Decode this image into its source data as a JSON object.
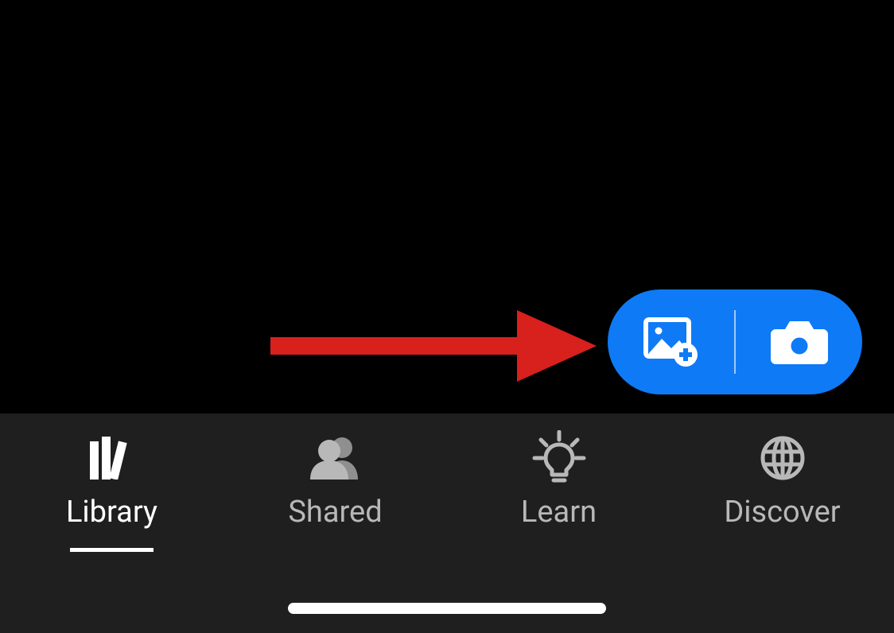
{
  "fab": {
    "add_photo_icon": "add-photo-icon",
    "camera_icon": "camera-icon",
    "accent_color": "#0f7af5"
  },
  "nav": {
    "items": [
      {
        "label": "Library",
        "icon": "library-icon",
        "active": true
      },
      {
        "label": "Shared",
        "icon": "people-icon",
        "active": false
      },
      {
        "label": "Learn",
        "icon": "lightbulb-icon",
        "active": false
      },
      {
        "label": "Discover",
        "icon": "globe-icon",
        "active": false
      }
    ]
  },
  "annotation": {
    "type": "red-arrow",
    "color": "#d8201d"
  }
}
